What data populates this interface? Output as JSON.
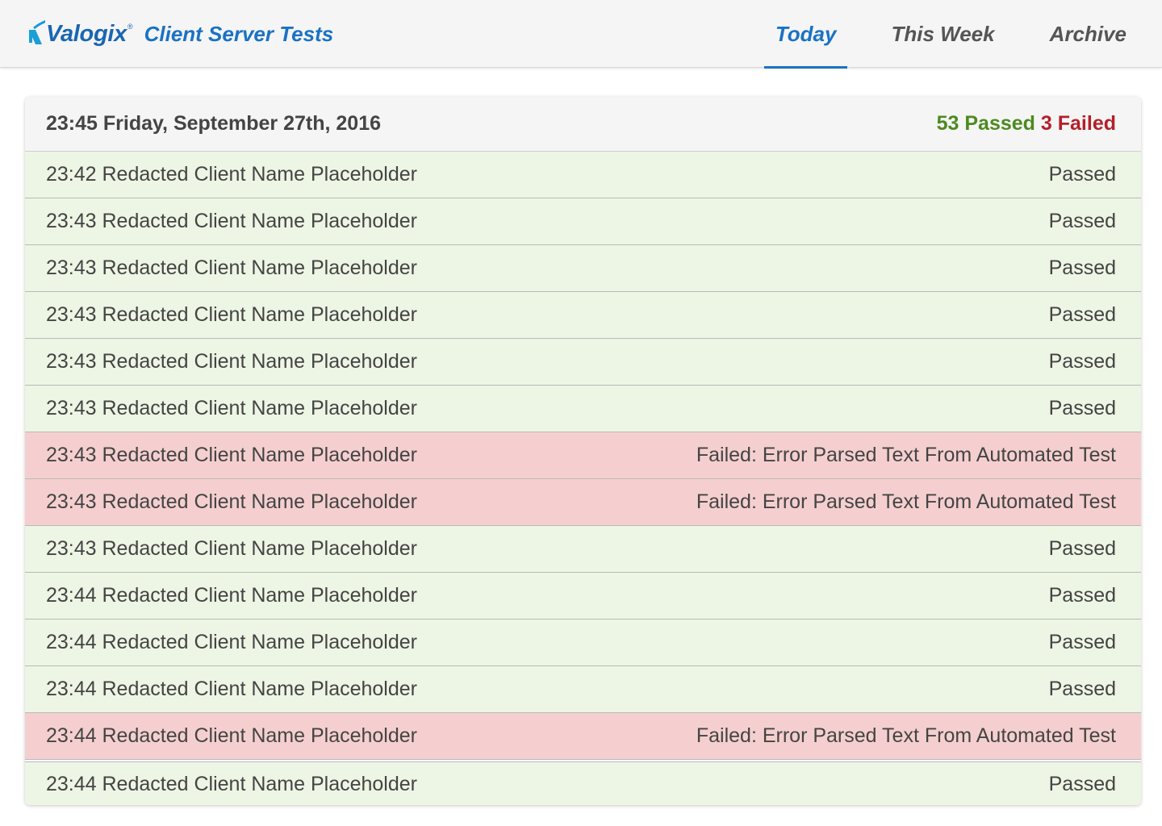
{
  "brand": {
    "logo_text": "Valogix",
    "logo_mark": "®",
    "app_title": "Client Server Tests"
  },
  "nav": [
    {
      "label": "Today",
      "active": true
    },
    {
      "label": "This Week",
      "active": false
    },
    {
      "label": "Archive",
      "active": false
    }
  ],
  "run": {
    "timestamp": "23:45 Friday, September 27th, 2016",
    "passed_label": "53 Passed",
    "failed_label": "3 Failed"
  },
  "results": [
    {
      "label": "23:42 Redacted Client Name Placeholder",
      "status": "Passed",
      "state": "passed"
    },
    {
      "label": "23:43 Redacted Client Name Placeholder",
      "status": "Passed",
      "state": "passed"
    },
    {
      "label": "23:43 Redacted Client Name Placeholder",
      "status": "Passed",
      "state": "passed"
    },
    {
      "label": "23:43 Redacted Client Name Placeholder",
      "status": "Passed",
      "state": "passed"
    },
    {
      "label": "23:43 Redacted Client Name Placeholder",
      "status": "Passed",
      "state": "passed"
    },
    {
      "label": "23:43 Redacted Client Name Placeholder",
      "status": "Passed",
      "state": "passed"
    },
    {
      "label": "23:43 Redacted Client Name Placeholder",
      "status": "Failed: Error Parsed Text From Automated Test",
      "state": "failed"
    },
    {
      "label": "23:43 Redacted Client Name Placeholder",
      "status": "Failed: Error Parsed Text From Automated Test",
      "state": "failed"
    },
    {
      "label": "23:43 Redacted Client Name Placeholder",
      "status": "Passed",
      "state": "passed"
    },
    {
      "label": "23:44 Redacted Client Name Placeholder",
      "status": "Passed",
      "state": "passed"
    },
    {
      "label": "23:44 Redacted Client Name Placeholder",
      "status": "Passed",
      "state": "passed"
    },
    {
      "label": "23:44 Redacted Client Name Placeholder",
      "status": "Passed",
      "state": "passed"
    },
    {
      "label": "23:44 Redacted Client Name Placeholder",
      "status": "Failed: Error Parsed Text From Automated Test",
      "state": "failed"
    },
    {
      "label": "23:44 Redacted Client Name Placeholder",
      "status": "Passed",
      "state": "passed"
    }
  ],
  "colors": {
    "brand_blue": "#1a72c4",
    "passed_text": "#4d8a1f",
    "failed_text": "#b3202a",
    "passed_row": "#edf5e4",
    "failed_row": "#f5cfcf"
  }
}
